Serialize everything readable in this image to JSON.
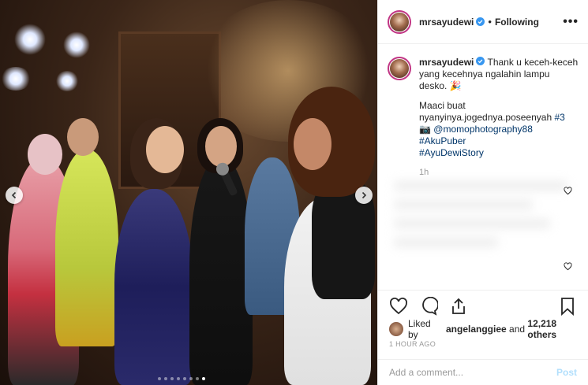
{
  "post": {
    "username": "mrsayudewi",
    "follow_status": "Following",
    "separator": "•",
    "more_icon": "more-icon"
  },
  "caption": {
    "username": "mrsayudewi",
    "line1": "Thank u keceh-keceh yang kecehnya ngalahin lampu desko. 🎉",
    "line2": "Maaci buat",
    "line3": "nyanyinya.jogednya.poseenyah",
    "hashtag3": "#3",
    "camera": "📷",
    "mention": "@momophotography88",
    "hashtag1": "#AkuPuber",
    "hashtag2": "#AyuDewiStory",
    "time": "1h"
  },
  "likes": {
    "prefix": "Liked by",
    "user": "angelanggiee",
    "joiner": "and",
    "count": "12,218 others"
  },
  "post_time": "1 HOUR AGO",
  "comment": {
    "placeholder": "Add a comment...",
    "post_label": "Post"
  },
  "carousel": {
    "dot_count": 8,
    "active_index": 7
  },
  "colors": {
    "verified": "#3897f0",
    "link": "#003569",
    "post_disabled": "#b2dffc",
    "avatar_ring": "#c13584"
  }
}
